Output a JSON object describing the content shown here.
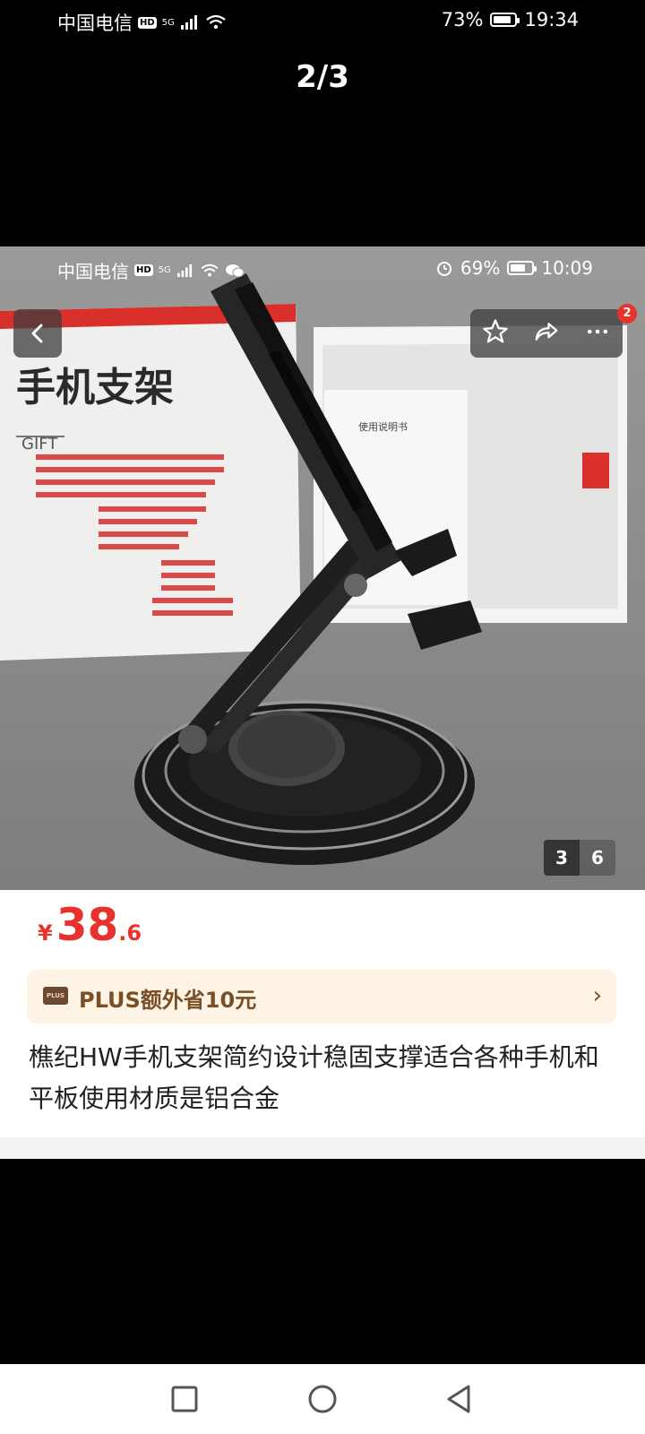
{
  "status_bar": {
    "carrier": "中国电信",
    "hd": "HD",
    "net": "5G",
    "battery": "73%",
    "time": "19:34"
  },
  "viewer": {
    "counter": "2/3"
  },
  "screenshot": {
    "inner_status": {
      "carrier": "中国电信",
      "hd": "HD",
      "net": "5G",
      "battery": "69%",
      "time": "10:09"
    },
    "photo": {
      "box_text": "手机支架",
      "box_gift": "GIFT",
      "manual_title": "使用说明书"
    },
    "notification_count": "2",
    "image_index": {
      "current": "3",
      "total": "6"
    },
    "price": {
      "currency": "¥",
      "integer": "38",
      "decimal": ".6"
    },
    "plus": {
      "icon_text": "PLUS",
      "text": "PLUS额外省10元",
      "arrow": "›"
    },
    "product_title": "樵纪HW手机支架简约设计稳固支撑适合各种手机和平板使用材质是铝合金"
  },
  "colors": {
    "price_red": "#e8322d",
    "plus_bg": "#fdf4e5",
    "plus_text": "#7b4f25"
  },
  "icons": [
    "signal-icon",
    "wifi-icon",
    "battery-icon",
    "back-icon",
    "star-icon",
    "share-icon",
    "more-icon",
    "alarm-icon",
    "wechat-icon",
    "plus-member-icon",
    "nav-recent-icon",
    "nav-home-icon",
    "nav-back-icon"
  ]
}
